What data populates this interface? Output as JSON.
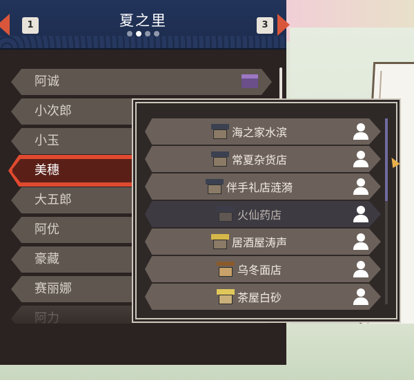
{
  "header": {
    "title": "夏之里",
    "prev_page": "1",
    "next_page": "3",
    "page_dots": 4,
    "active_dot": 1
  },
  "characters": [
    {
      "name": "阿诚",
      "has_shop_icon": true
    },
    {
      "name": "小次郎"
    },
    {
      "name": "小玉"
    },
    {
      "name": "美穗",
      "selected": true
    },
    {
      "name": "大五郎"
    },
    {
      "name": "阿优"
    },
    {
      "name": "豪藏"
    },
    {
      "name": "赛丽娜"
    },
    {
      "name": "阿力"
    }
  ],
  "shops": [
    {
      "name": "海之家水滨",
      "icon": "house-icon"
    },
    {
      "name": "常夏杂货店",
      "icon": "house-icon"
    },
    {
      "name": "伴手礼店涟漪",
      "icon": "house-icon"
    },
    {
      "name": "火仙药店",
      "icon": "house-icon",
      "dimmed": true
    },
    {
      "name": "居酒屋涛声",
      "icon": "thatched-house-icon"
    },
    {
      "name": "乌冬面店",
      "icon": "cart-icon"
    },
    {
      "name": "茶屋白砂",
      "icon": "tea-house-icon"
    }
  ],
  "colors": {
    "header_bg": "#22345b",
    "accent_red": "#e04a30",
    "panel_bg": "#2b2321",
    "item_bg": "#6b615a"
  }
}
